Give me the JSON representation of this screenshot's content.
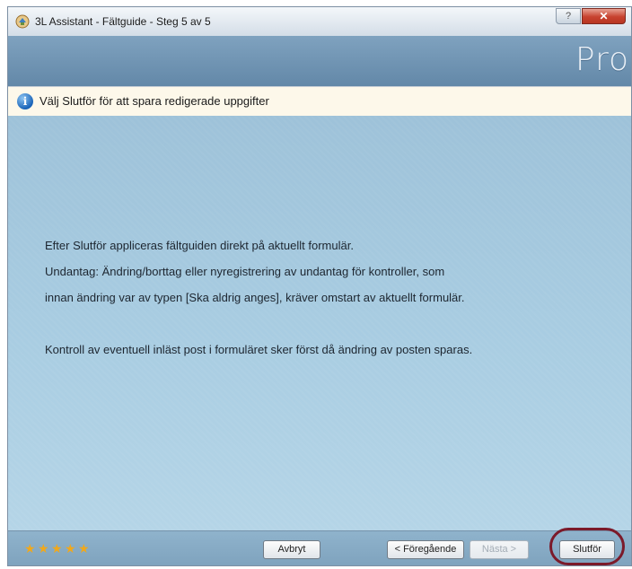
{
  "window": {
    "title": "3L Assistant - Fältguide - Steg 5 av 5",
    "help_label": "?",
    "close_label": "✕"
  },
  "banner": {
    "logo_text": "Pro"
  },
  "info": {
    "message": "Välj Slutför för att spara redigerade uppgifter"
  },
  "content": {
    "lines": [
      "Efter Slutför appliceras fältguiden direkt på aktuellt formulär.",
      "Undantag: Ändring/borttag eller nyregistrering av undantag för kontroller, som",
      "innan ändring var av typen [Ska aldrig anges], kräver omstart av aktuellt formulär.",
      "Kontroll av eventuell inläst post i formuläret sker först då ändring av posten sparas."
    ]
  },
  "footer": {
    "rating_stars": 5,
    "cancel_label": "Avbryt",
    "previous_label": "< Föregående",
    "next_label": "Nästa >",
    "finish_label": "Slutför"
  },
  "colors": {
    "banner": "#6f95b4",
    "content": "#a4c8de",
    "info_bar": "#fdf8ea",
    "highlight": "#7b1a2a",
    "stars": "#f0a81c"
  }
}
